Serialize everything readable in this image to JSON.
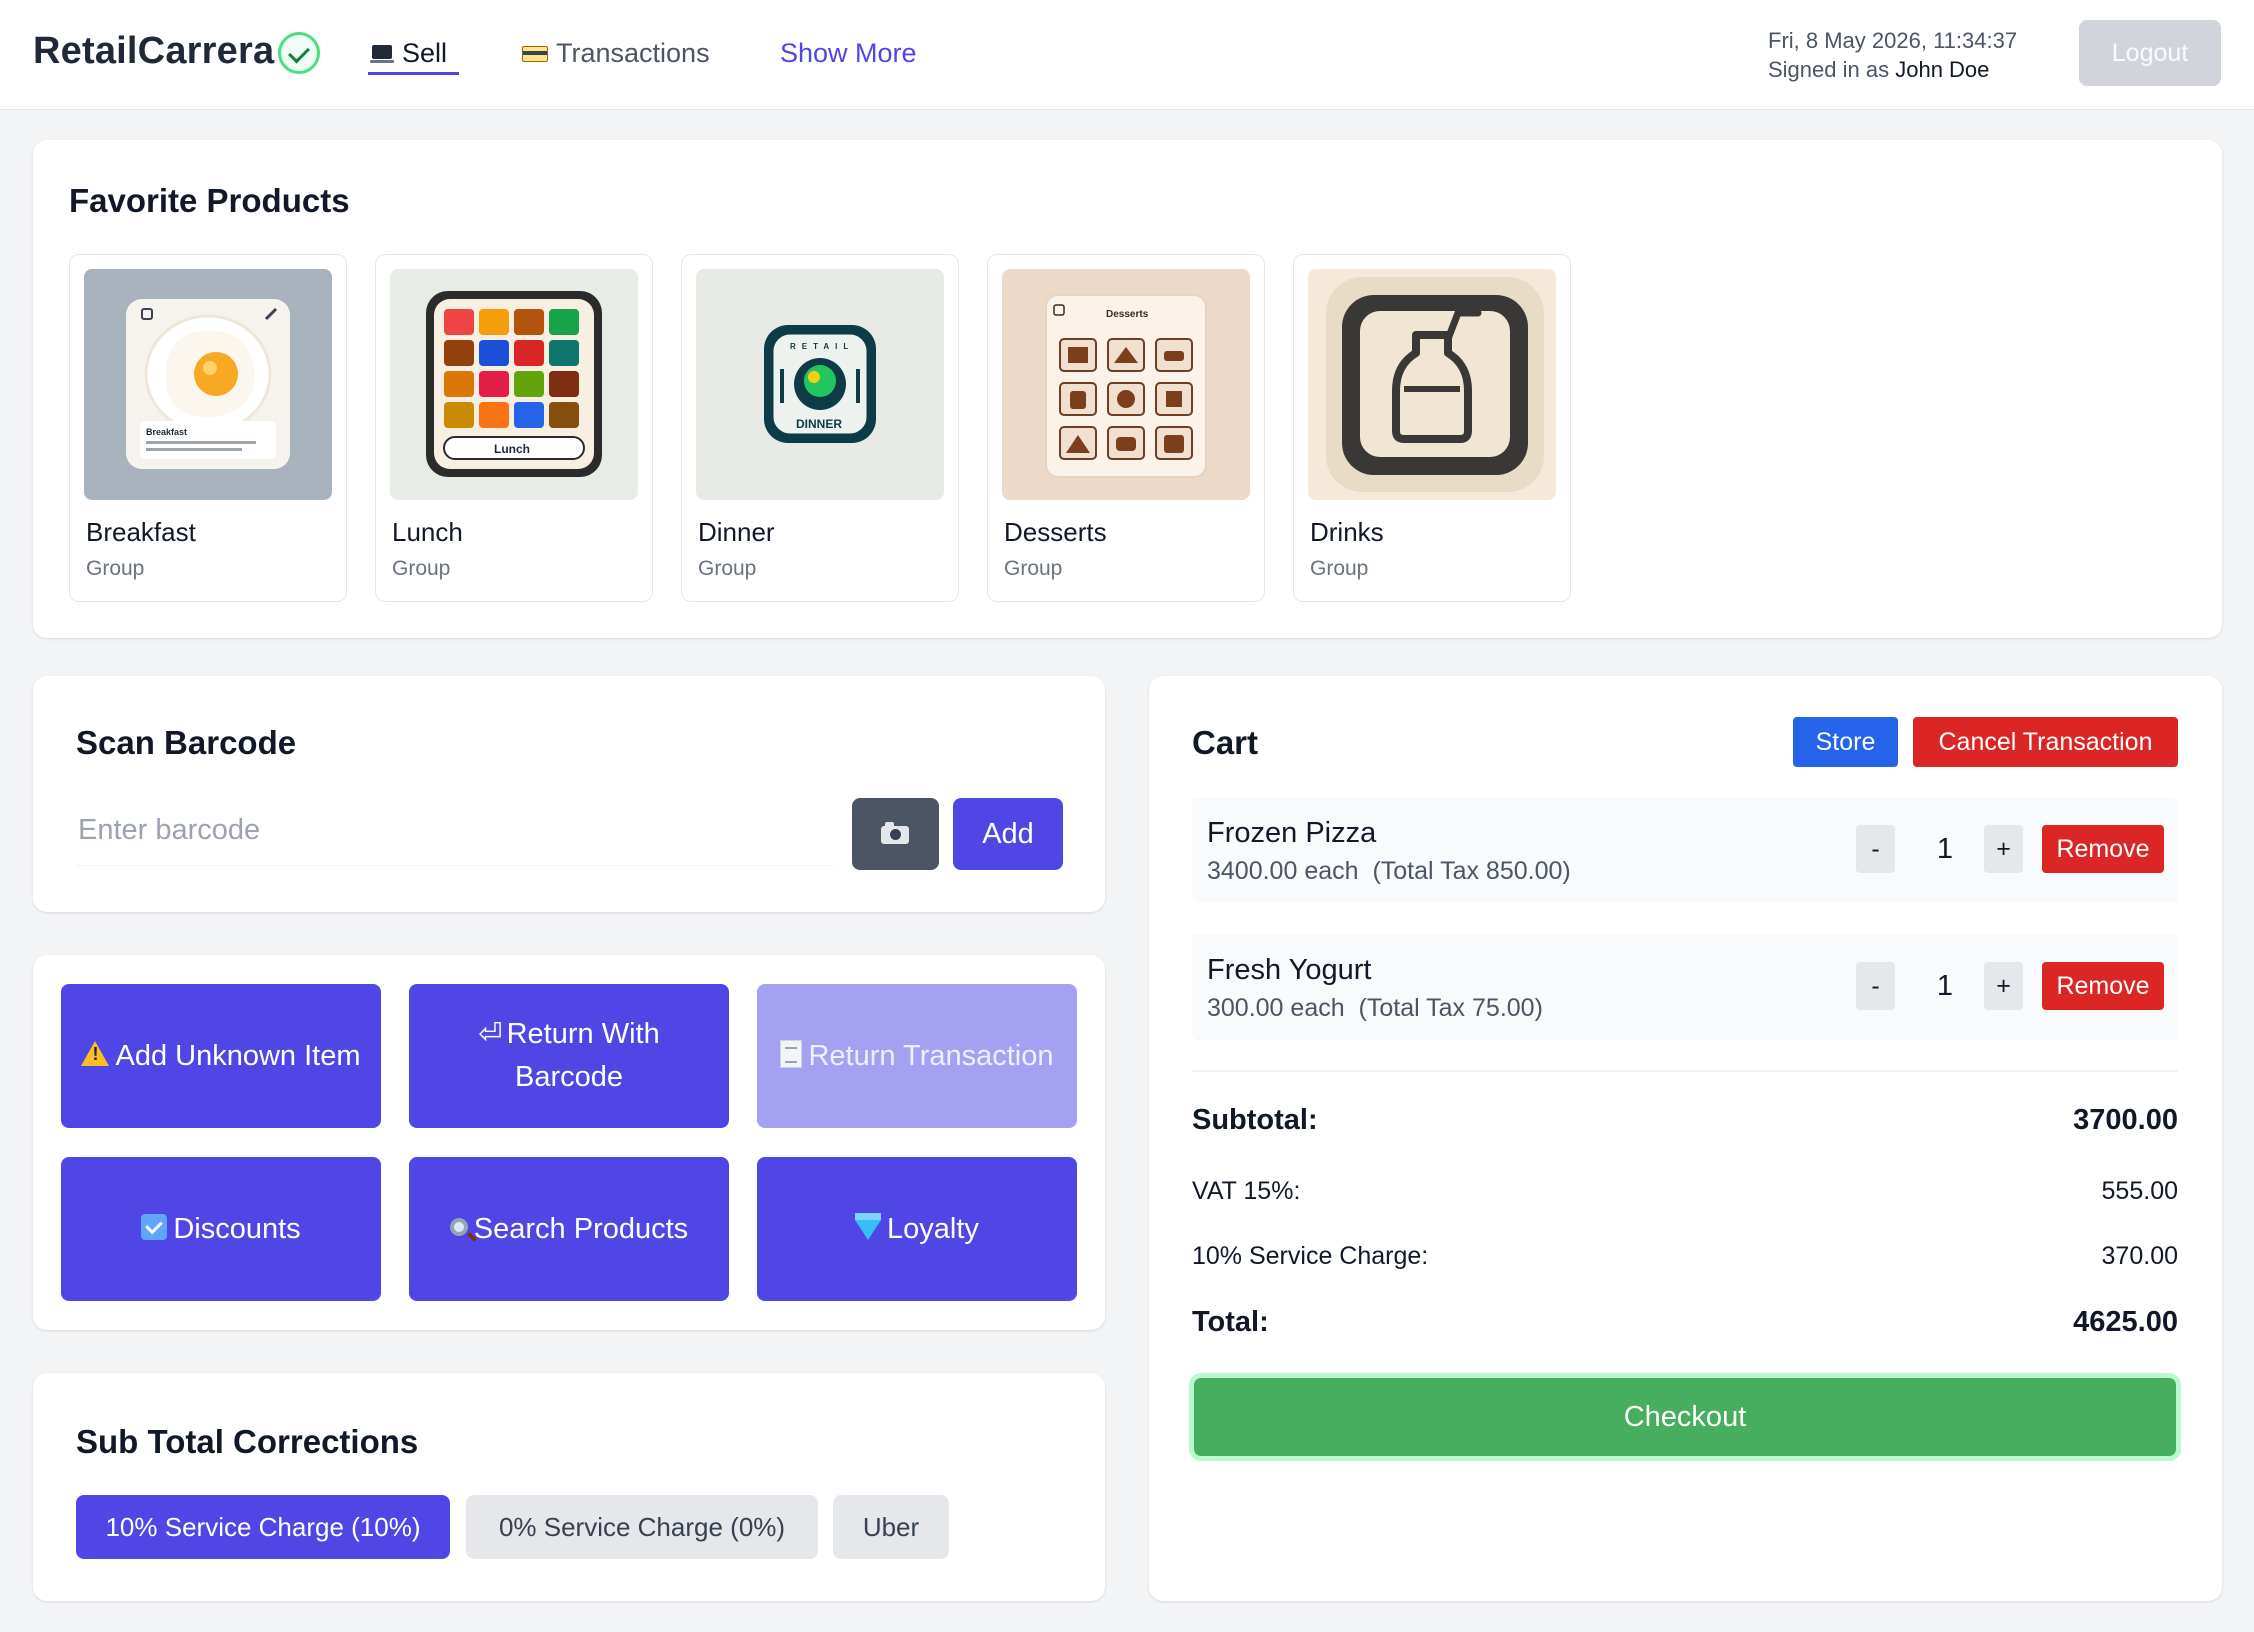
{
  "header": {
    "brand": "RetailCarrera",
    "nav": [
      {
        "label": "Sell",
        "icon": "laptop-icon",
        "active": true
      },
      {
        "label": "Transactions",
        "icon": "credit-card-icon",
        "active": false
      },
      {
        "label": "Show More",
        "active": false
      }
    ],
    "datetime": "Fri, 8 May 2026, 11:34:37",
    "signed_in_prefix": "Signed in as",
    "user_name": "John Doe",
    "logout_label": "Logout"
  },
  "favorites": {
    "title": "Favorite Products",
    "items": [
      {
        "name": "Breakfast",
        "type": "Group",
        "image": "breakfast-egg-icon"
      },
      {
        "name": "Lunch",
        "type": "Group",
        "image": "lunch-grid-icon"
      },
      {
        "name": "Dinner",
        "type": "Group",
        "image": "dinner-badge-icon"
      },
      {
        "name": "Desserts",
        "type": "Group",
        "image": "desserts-grid-icon"
      },
      {
        "name": "Drinks",
        "type": "Group",
        "image": "drink-bottle-icon"
      }
    ],
    "image_text": {
      "breakfast_caption": "Breakfast",
      "lunch_caption": "Lunch",
      "dinner_caption": "DINNER",
      "dinner_ring": "RETAIL",
      "desserts_caption": "Desserts"
    }
  },
  "scan": {
    "title": "Scan Barcode",
    "placeholder": "Enter barcode",
    "add_label": "Add"
  },
  "actions": [
    {
      "label": "Add Unknown Item",
      "icon": "warning-icon",
      "disabled": false
    },
    {
      "label": "Return With Barcode",
      "icon": "return-arrow-icon",
      "disabled": false
    },
    {
      "label": "Return Transaction",
      "icon": "receipt-icon",
      "disabled": true
    },
    {
      "label": "Discounts",
      "icon": "down-arrow-icon",
      "disabled": false
    },
    {
      "label": "Search Products",
      "icon": "magnifier-icon",
      "disabled": false
    },
    {
      "label": "Loyalty",
      "icon": "gem-icon",
      "disabled": false
    }
  ],
  "corrections": {
    "title": "Sub Total Corrections",
    "options": [
      {
        "label": "10% Service Charge (10%)",
        "active": true
      },
      {
        "label": "0% Service Charge (0%)",
        "active": false
      },
      {
        "label": "Uber",
        "active": false
      }
    ]
  },
  "cart": {
    "title": "Cart",
    "store_label": "Store",
    "cancel_label": "Cancel Transaction",
    "remove_label": "Remove",
    "minus_label": "-",
    "plus_label": "+",
    "items": [
      {
        "name": "Frozen Pizza",
        "price": "3400.00 each",
        "tax": "(Total Tax 850.00)",
        "qty": "1"
      },
      {
        "name": "Fresh Yogurt",
        "price": "300.00 each",
        "tax": "(Total Tax 75.00)",
        "qty": "1"
      }
    ],
    "subtotal_label": "Subtotal:",
    "subtotal": "3700.00",
    "vat_label": "VAT 15%:",
    "vat": "555.00",
    "service_label": "10% Service Charge:",
    "service": "370.00",
    "total_label": "Total:",
    "total": "4625.00",
    "checkout_label": "Checkout"
  },
  "colors": {
    "primary": "#4f46e5",
    "danger": "#dc2626",
    "store": "#2563eb",
    "success": "#48ae5f"
  }
}
